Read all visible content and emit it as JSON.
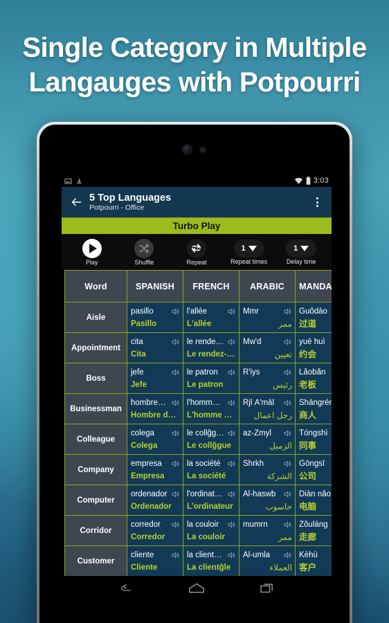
{
  "promo": {
    "headline_line1": "Single Category in Multiple",
    "headline_line2": "Langauges with Potpourri"
  },
  "colors": {
    "accent_green": "#9cbb1c",
    "cell_text_green": "#b9cf2a",
    "actionbar_navy": "#13384f",
    "cell_navy": "#123a56",
    "word_col_gray": "#3e4750",
    "grid_line": "#8ea31c",
    "bg_teal": "#3f94ad"
  },
  "statusbar": {
    "left_icons": [
      "screenshot-icon",
      "download-icon"
    ],
    "right_icons": [
      "wifi-icon",
      "battery-icon"
    ],
    "clock": "3:03"
  },
  "actionbar": {
    "back_icon": "back-arrow-icon",
    "title": "5 Top Languages",
    "subtitle": "Potpourri - Office",
    "overflow_icon": "overflow-menu-icon"
  },
  "turbo": {
    "label": "Turbo Play"
  },
  "toolbar": {
    "items": [
      {
        "icon": "play-icon",
        "label": "Play",
        "value": null,
        "enabled": true
      },
      {
        "icon": "shuffle-icon",
        "label": "Shuffle",
        "value": null,
        "enabled": false
      },
      {
        "icon": "repeat-icon",
        "label": "Repeat",
        "value": null,
        "enabled": true
      },
      {
        "icon": "dropdown-icon",
        "label": "Repeat times",
        "value": "1",
        "enabled": true
      },
      {
        "icon": "dropdown-icon",
        "label": "Delay time",
        "value": "1",
        "enabled": true
      }
    ]
  },
  "table": {
    "headers": [
      "Word",
      "SPANISH",
      "FRENCH",
      "ARABIC",
      "MANDARIN"
    ],
    "header_mandarin_visible": "MANDA",
    "rows": [
      {
        "word": "Aisle",
        "spanish": {
          "top": "pasillo",
          "bottom": "Pasillo"
        },
        "french": {
          "top": "l'allée",
          "bottom": "L'allée"
        },
        "arabic": {
          "top": "Mmr",
          "bottom": "ممر"
        },
        "mandarin": {
          "top": "Guǒdào",
          "bottom": "过道"
        }
      },
      {
        "word": "Appointment",
        "spanish": {
          "top": "cita",
          "bottom": "Cita"
        },
        "french": {
          "top": "le rendez…",
          "bottom": "Le rendez-vo…"
        },
        "arabic": {
          "top": "Mw'd",
          "bottom": "تعيين"
        },
        "mandarin": {
          "top": "yuē huì",
          "bottom": "约会"
        }
      },
      {
        "word": "Boss",
        "spanish": {
          "top": "jefe",
          "bottom": "Jefe"
        },
        "french": {
          "top": "le patron",
          "bottom": "Le patron"
        },
        "arabic": {
          "top": "R'iys",
          "bottom": "رئيس"
        },
        "mandarin": {
          "top": "Lǎobǎn",
          "bottom": "老板"
        }
      },
      {
        "word": "Businessman",
        "spanish": {
          "top": "hombre…",
          "bottom": "Hombre de n…"
        },
        "french": {
          "top": "l'homme…",
          "bottom": "L'homme d'a…"
        },
        "arabic": {
          "top": "Rjl Ā'māl",
          "bottom": "رجل اعمال"
        },
        "mandarin": {
          "top": "Shāngrén",
          "bottom": "商人"
        }
      },
      {
        "word": "Colleague",
        "spanish": {
          "top": "colega",
          "bottom": "Colega"
        },
        "french": {
          "top": "le collĝg…",
          "bottom": "Le collĝgue"
        },
        "arabic": {
          "top": "az-Zmyl",
          "bottom": "الزميل"
        },
        "mandarin": {
          "top": "Tóngshì",
          "bottom": "同事"
        }
      },
      {
        "word": "Company",
        "spanish": {
          "top": "empresa",
          "bottom": "Empresa"
        },
        "french": {
          "top": "la société",
          "bottom": "La société"
        },
        "arabic": {
          "top": "Shrkh",
          "bottom": "الشركة"
        },
        "mandarin": {
          "top": "Gōngsī",
          "bottom": "公司"
        }
      },
      {
        "word": "Computer",
        "spanish": {
          "top": "ordenador",
          "bottom": "Ordenador"
        },
        "french": {
          "top": "l'ordinat…",
          "bottom": "L'ordinateur"
        },
        "arabic": {
          "top": "Al-haswb",
          "bottom": "حاسوب"
        },
        "mandarin": {
          "top": "Diàn nǎo",
          "bottom": "电脑"
        }
      },
      {
        "word": "Corridor",
        "spanish": {
          "top": "corredor",
          "bottom": "Corredor"
        },
        "french": {
          "top": "la couloir",
          "bottom": "La couloir"
        },
        "arabic": {
          "top": "mumrn",
          "bottom": "ممر"
        },
        "mandarin": {
          "top": "Zǒuláng",
          "bottom": "走廊"
        }
      },
      {
        "word": "Customer",
        "spanish": {
          "top": "cliente",
          "bottom": "Cliente"
        },
        "french": {
          "top": "la clientĝ…",
          "bottom": "La clientĝle"
        },
        "arabic": {
          "top": "Al-umla",
          "bottom": "العملاء"
        },
        "mandarin": {
          "top": "Kèhù",
          "bottom": "客户"
        }
      }
    ]
  },
  "navbar": {
    "buttons": [
      {
        "icon": "nav-back-icon",
        "label": "Back"
      },
      {
        "icon": "nav-home-icon",
        "label": "Home"
      },
      {
        "icon": "nav-recents-icon",
        "label": "Recents"
      }
    ]
  }
}
